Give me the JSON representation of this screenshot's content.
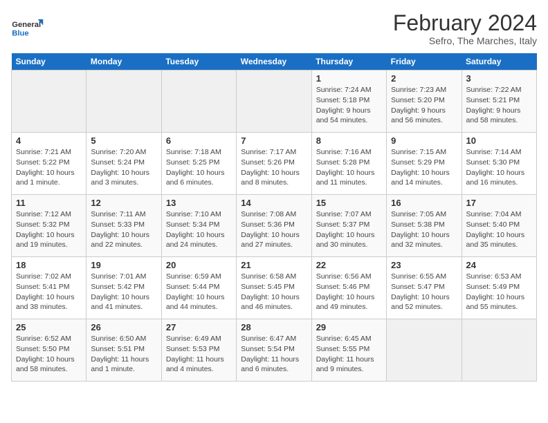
{
  "header": {
    "logo_line1": "General",
    "logo_line2": "Blue",
    "month": "February 2024",
    "location": "Sefro, The Marches, Italy"
  },
  "weekdays": [
    "Sunday",
    "Monday",
    "Tuesday",
    "Wednesday",
    "Thursday",
    "Friday",
    "Saturday"
  ],
  "weeks": [
    [
      {
        "day": "",
        "info": ""
      },
      {
        "day": "",
        "info": ""
      },
      {
        "day": "",
        "info": ""
      },
      {
        "day": "",
        "info": ""
      },
      {
        "day": "1",
        "info": "Sunrise: 7:24 AM\nSunset: 5:18 PM\nDaylight: 9 hours\nand 54 minutes."
      },
      {
        "day": "2",
        "info": "Sunrise: 7:23 AM\nSunset: 5:20 PM\nDaylight: 9 hours\nand 56 minutes."
      },
      {
        "day": "3",
        "info": "Sunrise: 7:22 AM\nSunset: 5:21 PM\nDaylight: 9 hours\nand 58 minutes."
      }
    ],
    [
      {
        "day": "4",
        "info": "Sunrise: 7:21 AM\nSunset: 5:22 PM\nDaylight: 10 hours\nand 1 minute."
      },
      {
        "day": "5",
        "info": "Sunrise: 7:20 AM\nSunset: 5:24 PM\nDaylight: 10 hours\nand 3 minutes."
      },
      {
        "day": "6",
        "info": "Sunrise: 7:18 AM\nSunset: 5:25 PM\nDaylight: 10 hours\nand 6 minutes."
      },
      {
        "day": "7",
        "info": "Sunrise: 7:17 AM\nSunset: 5:26 PM\nDaylight: 10 hours\nand 8 minutes."
      },
      {
        "day": "8",
        "info": "Sunrise: 7:16 AM\nSunset: 5:28 PM\nDaylight: 10 hours\nand 11 minutes."
      },
      {
        "day": "9",
        "info": "Sunrise: 7:15 AM\nSunset: 5:29 PM\nDaylight: 10 hours\nand 14 minutes."
      },
      {
        "day": "10",
        "info": "Sunrise: 7:14 AM\nSunset: 5:30 PM\nDaylight: 10 hours\nand 16 minutes."
      }
    ],
    [
      {
        "day": "11",
        "info": "Sunrise: 7:12 AM\nSunset: 5:32 PM\nDaylight: 10 hours\nand 19 minutes."
      },
      {
        "day": "12",
        "info": "Sunrise: 7:11 AM\nSunset: 5:33 PM\nDaylight: 10 hours\nand 22 minutes."
      },
      {
        "day": "13",
        "info": "Sunrise: 7:10 AM\nSunset: 5:34 PM\nDaylight: 10 hours\nand 24 minutes."
      },
      {
        "day": "14",
        "info": "Sunrise: 7:08 AM\nSunset: 5:36 PM\nDaylight: 10 hours\nand 27 minutes."
      },
      {
        "day": "15",
        "info": "Sunrise: 7:07 AM\nSunset: 5:37 PM\nDaylight: 10 hours\nand 30 minutes."
      },
      {
        "day": "16",
        "info": "Sunrise: 7:05 AM\nSunset: 5:38 PM\nDaylight: 10 hours\nand 32 minutes."
      },
      {
        "day": "17",
        "info": "Sunrise: 7:04 AM\nSunset: 5:40 PM\nDaylight: 10 hours\nand 35 minutes."
      }
    ],
    [
      {
        "day": "18",
        "info": "Sunrise: 7:02 AM\nSunset: 5:41 PM\nDaylight: 10 hours\nand 38 minutes."
      },
      {
        "day": "19",
        "info": "Sunrise: 7:01 AM\nSunset: 5:42 PM\nDaylight: 10 hours\nand 41 minutes."
      },
      {
        "day": "20",
        "info": "Sunrise: 6:59 AM\nSunset: 5:44 PM\nDaylight: 10 hours\nand 44 minutes."
      },
      {
        "day": "21",
        "info": "Sunrise: 6:58 AM\nSunset: 5:45 PM\nDaylight: 10 hours\nand 46 minutes."
      },
      {
        "day": "22",
        "info": "Sunrise: 6:56 AM\nSunset: 5:46 PM\nDaylight: 10 hours\nand 49 minutes."
      },
      {
        "day": "23",
        "info": "Sunrise: 6:55 AM\nSunset: 5:47 PM\nDaylight: 10 hours\nand 52 minutes."
      },
      {
        "day": "24",
        "info": "Sunrise: 6:53 AM\nSunset: 5:49 PM\nDaylight: 10 hours\nand 55 minutes."
      }
    ],
    [
      {
        "day": "25",
        "info": "Sunrise: 6:52 AM\nSunset: 5:50 PM\nDaylight: 10 hours\nand 58 minutes."
      },
      {
        "day": "26",
        "info": "Sunrise: 6:50 AM\nSunset: 5:51 PM\nDaylight: 11 hours\nand 1 minute."
      },
      {
        "day": "27",
        "info": "Sunrise: 6:49 AM\nSunset: 5:53 PM\nDaylight: 11 hours\nand 4 minutes."
      },
      {
        "day": "28",
        "info": "Sunrise: 6:47 AM\nSunset: 5:54 PM\nDaylight: 11 hours\nand 6 minutes."
      },
      {
        "day": "29",
        "info": "Sunrise: 6:45 AM\nSunset: 5:55 PM\nDaylight: 11 hours\nand 9 minutes."
      },
      {
        "day": "",
        "info": ""
      },
      {
        "day": "",
        "info": ""
      }
    ]
  ]
}
